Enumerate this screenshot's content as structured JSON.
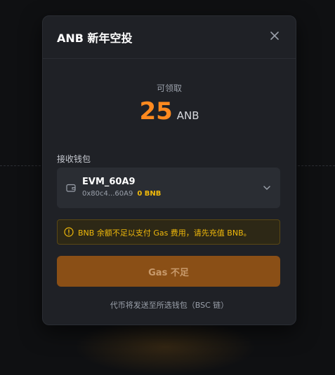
{
  "modal": {
    "title": "ANB 新年空投",
    "close_icon": "close-icon"
  },
  "claim": {
    "label": "可领取",
    "amount": "25",
    "unit": "ANB",
    "amount_color": "#ff8a1f"
  },
  "wallet": {
    "section_label": "接收钱包",
    "name": "EVM_60A9",
    "address": "0x80c4...60A9",
    "balance": "0 BNB",
    "icon": "wallet-icon",
    "dropdown_icon": "chevron-down-icon"
  },
  "warning": {
    "icon": "warning-icon",
    "text": "BNB 余额不足以支付 Gas 费用，请先充值 BNB。",
    "color": "#f0b90b"
  },
  "action": {
    "button_label": "Gas 不足",
    "button_color": "#8a4f16"
  },
  "footer": {
    "note": "代币将发送至所选钱包（BSC 链）"
  }
}
